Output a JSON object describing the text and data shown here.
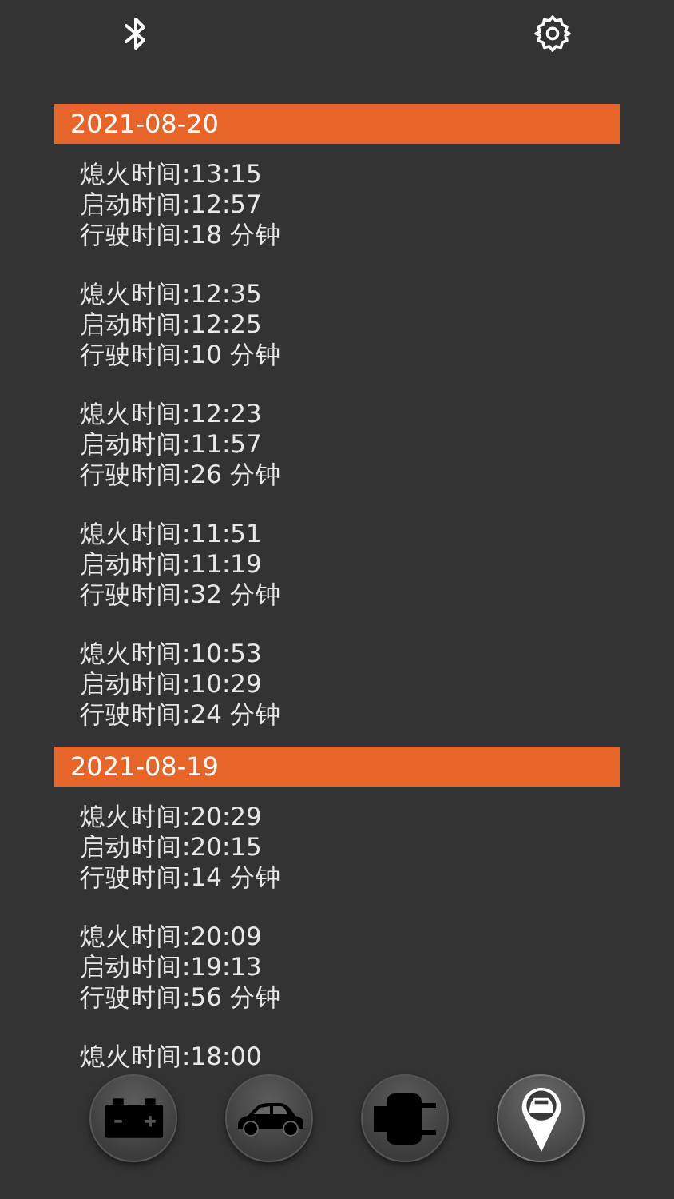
{
  "sections": [
    {
      "date": "2021-08-20",
      "trips": [
        {
          "lines": [
            "熄火时间:13:15",
            "启动时间:12:57",
            "行驶时间:18 分钟"
          ]
        },
        {
          "lines": [
            "熄火时间:12:35",
            "启动时间:12:25",
            "行驶时间:10 分钟"
          ]
        },
        {
          "lines": [
            "熄火时间:12:23",
            "启动时间:11:57",
            "行驶时间:26 分钟"
          ]
        },
        {
          "lines": [
            "熄火时间:11:51",
            "启动时间:11:19",
            "行驶时间:32 分钟"
          ]
        },
        {
          "lines": [
            "熄火时间:10:53",
            "启动时间:10:29",
            "行驶时间:24 分钟"
          ]
        }
      ]
    },
    {
      "date": "2021-08-19",
      "trips": [
        {
          "lines": [
            "熄火时间:20:29",
            "启动时间:20:15",
            "行驶时间:14 分钟"
          ]
        },
        {
          "lines": [
            "熄火时间:20:09",
            "启动时间:19:13",
            "行驶时间:56 分钟"
          ]
        },
        {
          "lines": [
            "熄火时间:18:00"
          ]
        }
      ]
    }
  ],
  "nav": [
    {
      "kind": "battery",
      "selected": false
    },
    {
      "kind": "car",
      "selected": false
    },
    {
      "kind": "plug",
      "selected": false
    },
    {
      "kind": "locate",
      "selected": true
    }
  ]
}
